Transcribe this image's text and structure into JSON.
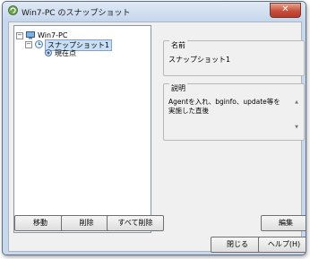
{
  "window": {
    "title": "Win7-PC のスナップショット",
    "close_label": "✕"
  },
  "tree": {
    "root": "Win7-PC",
    "snapshot": "スナップショット1",
    "current": "現在点"
  },
  "details": {
    "name_label": "名前",
    "name_value": "スナップショット1",
    "description_label": "説明",
    "description_value": "Agentを入れ、bginfo、update等を実施した直後"
  },
  "buttons": {
    "move": "移動",
    "delete": "削除",
    "delete_all": "すべて削除",
    "edit": "編集",
    "close": "閉じる",
    "help": "ヘルプ(H)"
  },
  "icons": {
    "app": "snapshot-app-icon",
    "vm": "vm-icon",
    "snapshot": "snapshot-icon",
    "current": "current-position-icon"
  }
}
